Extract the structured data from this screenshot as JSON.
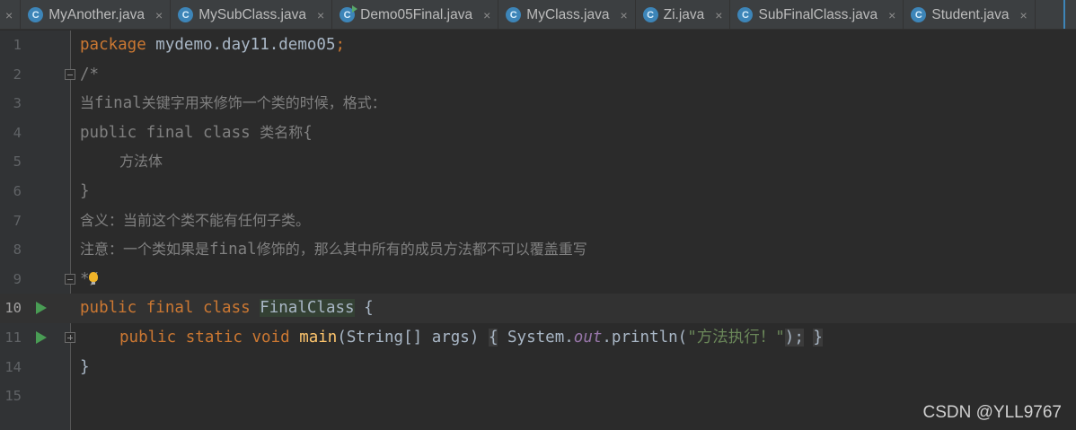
{
  "tabs": [
    {
      "label": "MyAnother.java",
      "icon": "class-icon"
    },
    {
      "label": "MySubClass.java",
      "icon": "class-icon"
    },
    {
      "label": "Demo05Final.java",
      "icon": "runnable-class-icon"
    },
    {
      "label": "MyClass.java",
      "icon": "class-icon"
    },
    {
      "label": "Zi.java",
      "icon": "class-icon"
    },
    {
      "label": "SubFinalClass.java",
      "icon": "class-icon"
    },
    {
      "label": "Student.java",
      "icon": "class-icon"
    }
  ],
  "tab_close_glyph": "×",
  "class_icon_letter": "C",
  "line_numbers": [
    "1",
    "2",
    "3",
    "4",
    "5",
    "6",
    "7",
    "8",
    "9",
    "10",
    "11",
    "14",
    "15"
  ],
  "code": {
    "l1_kw": "package",
    "l1_rest": " mydemo.day11.demo05",
    "l1_semi": ";",
    "l2": "/*",
    "l3_a": "当",
    "l3_b": "final",
    "l3_c": "关键字用来修饰一个类的时候，格式：",
    "l4_a": "public final class ",
    "l4_b": "类名称",
    "l4_c": "{",
    "l5": "方法体",
    "l6": "}",
    "l7": "含义：当前这个类不能有任何子类。",
    "l8_a": "注意：一个类如果是",
    "l8_b": "final",
    "l8_c": "修饰的，那么其中所有的成员方法都不可以覆盖重写",
    "l9": "*/",
    "l10_kw": "public final class ",
    "l10_cls": "FinalClass",
    "l10_rest": " {",
    "l11_kw": "public static void ",
    "l11_fn": "main",
    "l11_args": "(String[] args)",
    "l11_open": "{",
    "l11_sys": " System.",
    "l11_out": "out",
    "l11_print": ".println(",
    "l11_str": "\"方法执行！\"",
    "l11_end": ");",
    "l11_close": "}",
    "l14": "}"
  },
  "watermark": "CSDN @YLL9767",
  "colors": {
    "background": "#2b2b2b",
    "keyword": "#cc7832",
    "comment": "#808080",
    "string": "#6a8759",
    "function": "#ffc66d",
    "static_field": "#9876aa",
    "run_icon": "#499c54"
  }
}
